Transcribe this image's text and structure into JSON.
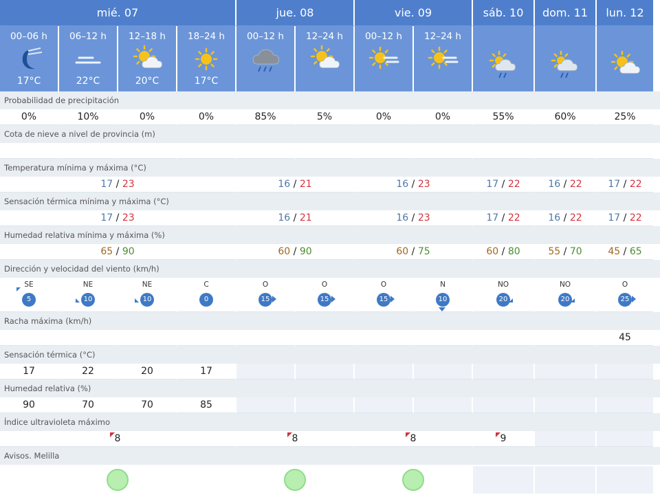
{
  "days": [
    {
      "label": "mié. 07",
      "span": 4
    },
    {
      "label": "jue. 08",
      "span": 2
    },
    {
      "label": "vie. 09",
      "span": 2
    },
    {
      "label": "sáb. 10",
      "span": 1
    },
    {
      "label": "dom. 11",
      "span": 1
    },
    {
      "label": "lun. 12",
      "span": 1
    }
  ],
  "periods": [
    {
      "label": "00–06 h",
      "icon": "moon-windy-icon",
      "temp": "17°C"
    },
    {
      "label": "06–12 h",
      "icon": "haze-icon",
      "temp": "22°C"
    },
    {
      "label": "12–18 h",
      "icon": "sun-cloud-icon",
      "temp": "20°C"
    },
    {
      "label": "18–24 h",
      "icon": "sun-icon",
      "temp": "17°C"
    },
    {
      "label": "00–12 h",
      "icon": "storm-cloud-icon",
      "temp": ""
    },
    {
      "label": "12–24 h",
      "icon": "sun-cloud-icon",
      "temp": ""
    },
    {
      "label": "00–12 h",
      "icon": "sun-haze-icon",
      "temp": ""
    },
    {
      "label": "12–24 h",
      "icon": "sun-haze-icon",
      "temp": ""
    },
    {
      "label": "",
      "icon": "sun-rain-cloud-icon",
      "temp": ""
    },
    {
      "label": "",
      "icon": "sun-rain-cloud-icon",
      "temp": ""
    },
    {
      "label": "",
      "icon": "sun-cloud-icon",
      "temp": ""
    }
  ],
  "labels": {
    "precip": "Probabilidad de precipitación",
    "snow": "Cota de nieve a nivel de provincia (m)",
    "temp": "Temperatura mínima y máxima (°C)",
    "feel": "Sensación térmica mínima y máxima (°C)",
    "humid": "Humedad relativa mínima y máxima (%)",
    "wind": "Dirección y velocidad del viento (km/h)",
    "gust": "Racha máxima (km/h)",
    "feelp": "Sensación térmica (°C)",
    "humidp": "Humedad relativa (%)",
    "uv": "Índice ultravioleta máximo",
    "alerts": "Avisos. Melilla"
  },
  "precip": [
    "0%",
    "10%",
    "0%",
    "0%",
    "85%",
    "5%",
    "0%",
    "0%",
    "55%",
    "60%",
    "25%"
  ],
  "temp": [
    {
      "min": "17",
      "max": "23"
    },
    {
      "min": "16",
      "max": "21"
    },
    {
      "min": "16",
      "max": "23"
    },
    {
      "min": "17",
      "max": "22"
    },
    {
      "min": "16",
      "max": "22"
    },
    {
      "min": "17",
      "max": "22"
    }
  ],
  "feel": [
    {
      "min": "17",
      "max": "23"
    },
    {
      "min": "16",
      "max": "21"
    },
    {
      "min": "16",
      "max": "23"
    },
    {
      "min": "17",
      "max": "22"
    },
    {
      "min": "16",
      "max": "22"
    },
    {
      "min": "17",
      "max": "22"
    }
  ],
  "humid": [
    {
      "min": "65",
      "max": "90"
    },
    {
      "min": "60",
      "max": "90"
    },
    {
      "min": "60",
      "max": "75"
    },
    {
      "min": "60",
      "max": "80"
    },
    {
      "min": "55",
      "max": "70"
    },
    {
      "min": "45",
      "max": "65"
    }
  ],
  "wind": [
    {
      "dir": "SE",
      "speed": "5"
    },
    {
      "dir": "NE",
      "speed": "10"
    },
    {
      "dir": "NE",
      "speed": "10"
    },
    {
      "dir": "C",
      "speed": "0"
    },
    {
      "dir": "O",
      "speed": "15"
    },
    {
      "dir": "O",
      "speed": "15"
    },
    {
      "dir": "O",
      "speed": "15"
    },
    {
      "dir": "N",
      "speed": "10"
    },
    {
      "dir": "NO",
      "speed": "20"
    },
    {
      "dir": "NO",
      "speed": "20"
    },
    {
      "dir": "O",
      "speed": "25"
    }
  ],
  "gust": [
    "",
    "",
    "",
    "",
    "",
    "",
    "",
    "",
    "",
    "",
    "45"
  ],
  "feelp": [
    "17",
    "22",
    "20",
    "17"
  ],
  "humidp": [
    "90",
    "70",
    "70",
    "85"
  ],
  "uv": [
    "8",
    "8",
    "8",
    "9"
  ],
  "colors": {
    "header_day": "#4f7fcc",
    "header_period": "#6b95d8",
    "label_bg": "#e9eef3",
    "min": "#5077a8",
    "max": "#d3323d",
    "humid_min": "#a0671c",
    "humid_max": "#4a8d2f",
    "wind_badge": "#3f79c5",
    "alert_green": "#b8eeb0"
  }
}
